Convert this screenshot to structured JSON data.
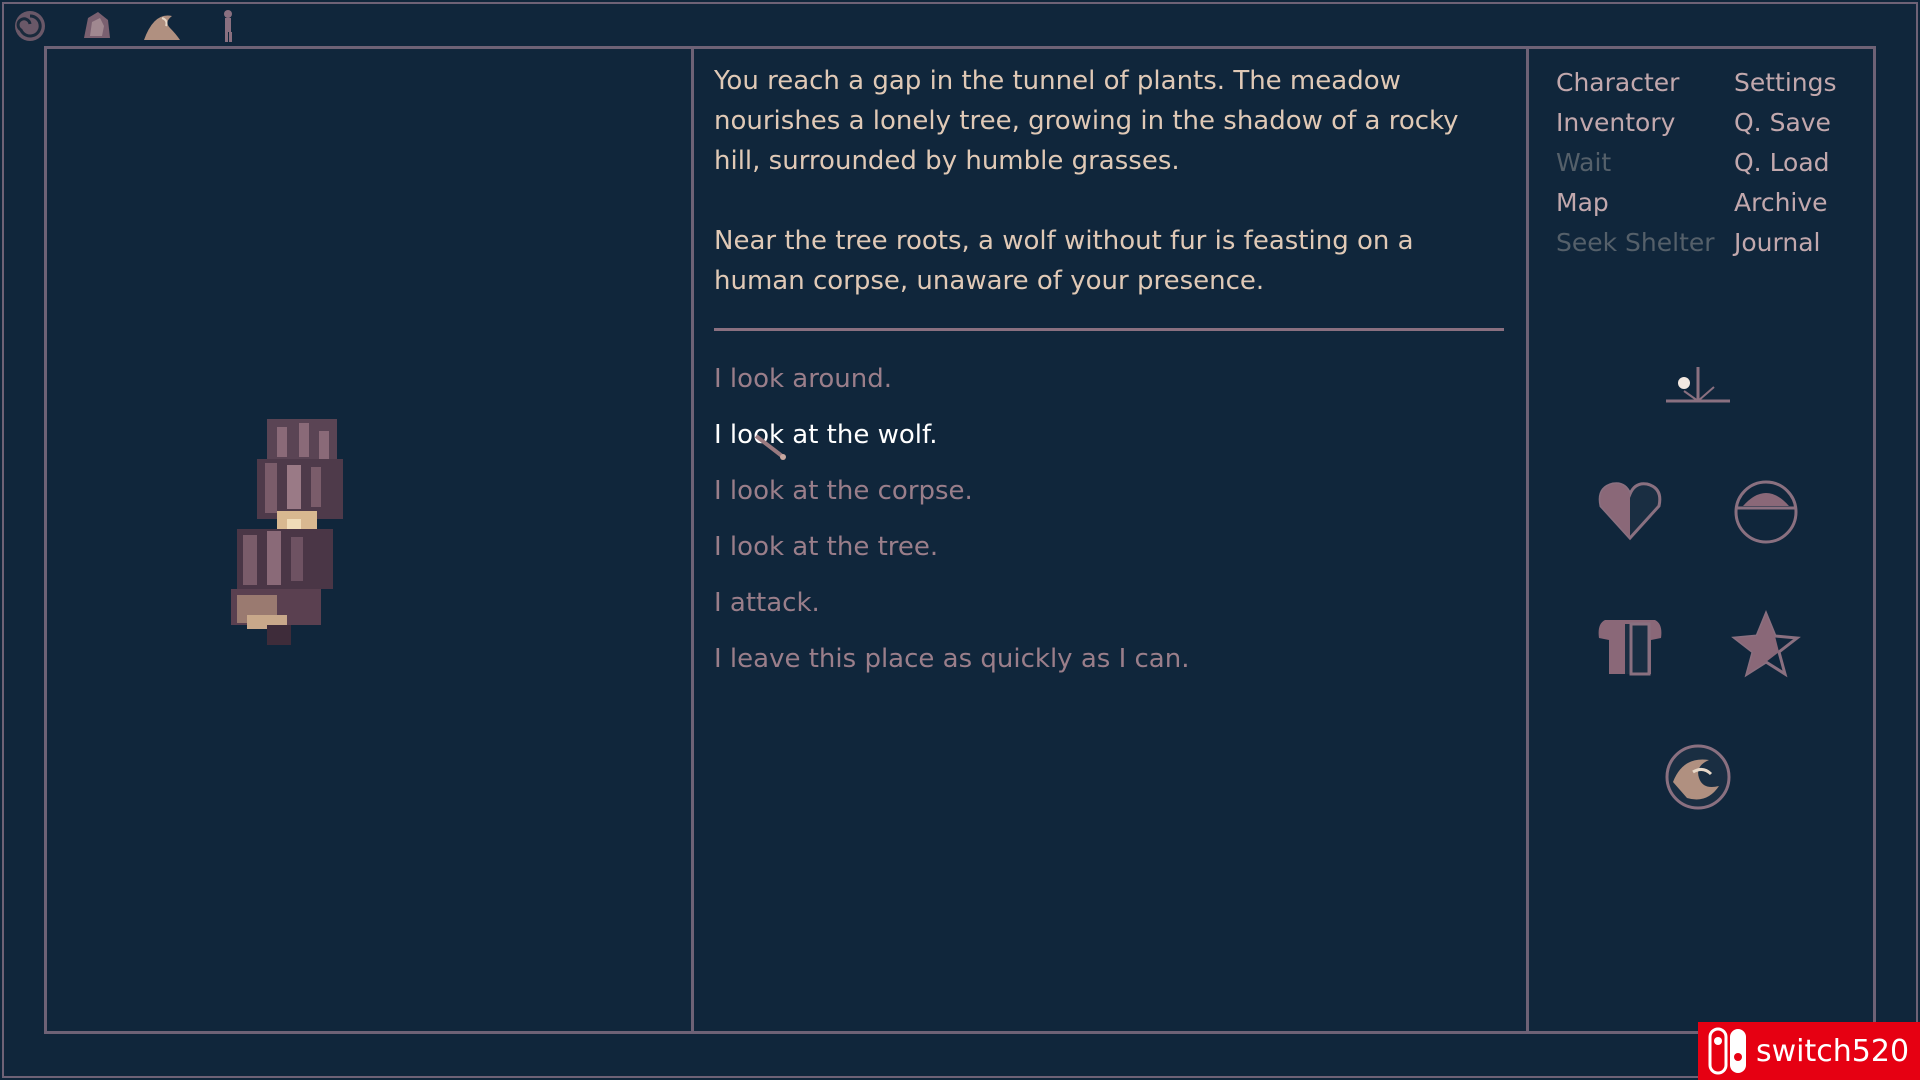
{
  "top_icons": [
    "spiral-icon",
    "rock-icon",
    "wave-icon",
    "figure-icon"
  ],
  "narrative": {
    "paragraphs": [
      "You reach a gap in the tunnel of plants. The meadow nourishes a lonely tree, growing in the shadow of a rocky hill, surrounded by humble grasses.",
      "Near the tree roots, a wolf without fur is feasting on a human corpse, unaware of your presence."
    ]
  },
  "choices": [
    {
      "label": "I look around.",
      "active": false
    },
    {
      "label": "I look at the wolf.",
      "active": true
    },
    {
      "label": "I look at the corpse.",
      "active": false
    },
    {
      "label": "I look at the tree.",
      "active": false
    },
    {
      "label": "I attack.",
      "active": false
    },
    {
      "label": "I leave this place as quickly as I can.",
      "active": false
    }
  ],
  "menu": {
    "character": "Character",
    "settings": "Settings",
    "inventory": "Inventory",
    "quick_save": "Q. Save",
    "wait": "Wait",
    "quick_load": "Q. Load",
    "map": "Map",
    "archive": "Archive",
    "seek_shelter": "Seek Shelter",
    "journal": "Journal"
  },
  "status_icons": [
    "sundial-icon",
    "heart-icon",
    "food-bowl-icon",
    "clothing-icon",
    "star-icon",
    "orb-icon"
  ],
  "colors": {
    "background": "#10263b",
    "border": "#6e6276",
    "text": "#e0c9b6",
    "choice": "#9a7e8a",
    "choice_active": "#ffffff",
    "menu_dim": "#55606a"
  },
  "watermark": {
    "text": "switch520"
  }
}
